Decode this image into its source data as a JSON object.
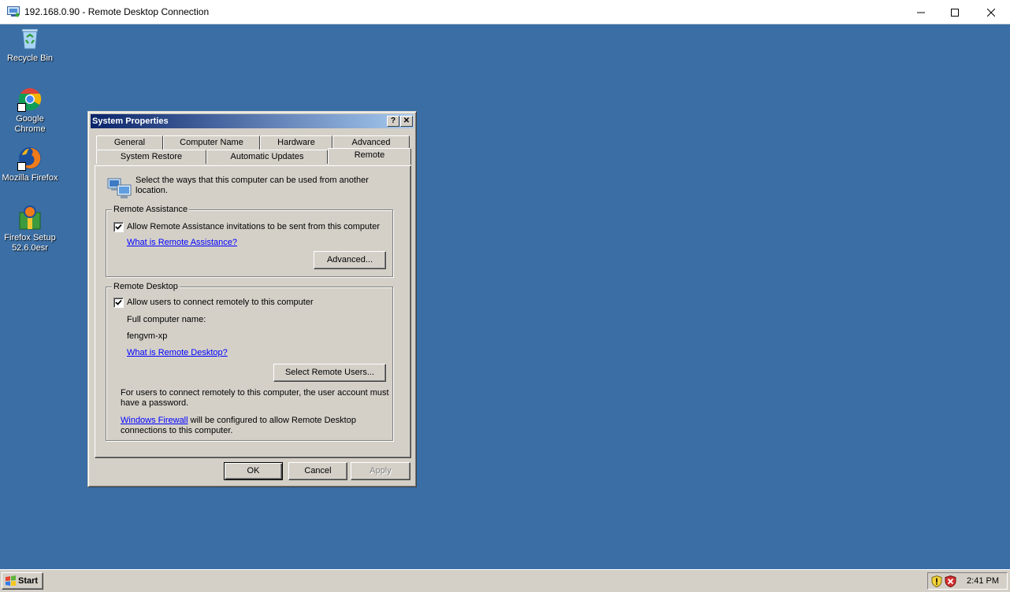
{
  "rdp_window": {
    "title": "192.168.0.90 - Remote Desktop Connection",
    "minimize_icon": "minimize-icon",
    "maximize_icon": "maximize-icon",
    "close_icon": "close-icon"
  },
  "desktop_icons": [
    {
      "label": "Recycle Bin",
      "icon": "recycle-bin-icon"
    },
    {
      "label": "Google Chrome",
      "icon": "chrome-icon"
    },
    {
      "label": "Mozilla Firefox",
      "icon": "firefox-icon"
    },
    {
      "label": "Firefox Setup 52.6.0esr",
      "icon": "installer-icon"
    }
  ],
  "dialog": {
    "title": "System Properties",
    "help_glyph": "?",
    "close_glyph": "✕",
    "tabs_row1": [
      "General",
      "Computer Name",
      "Hardware",
      "Advanced"
    ],
    "tabs_row2": [
      "System Restore",
      "Automatic Updates",
      "Remote"
    ],
    "active_tab": "Remote",
    "intro_line1": "Select the ways that this computer can be used from another",
    "intro_line2": "location.",
    "remote_assistance": {
      "group_title": "Remote Assistance",
      "checkbox_label": "Allow Remote Assistance invitations to be sent from this computer",
      "checked": true,
      "link": "What is Remote Assistance?",
      "advanced_button": "Advanced..."
    },
    "remote_desktop": {
      "group_title": "Remote Desktop",
      "checkbox_label": "Allow users to connect remotely to this computer",
      "checked": true,
      "full_name_label": "Full computer name:",
      "computer_name": "fengvm-xp",
      "link": "What is Remote Desktop?",
      "select_users_button": "Select Remote Users...",
      "note_line1": "For users to connect remotely to this computer, the user account must",
      "note_line2": "have a password.",
      "firewall_link": "Windows Firewall",
      "firewall_text1": " will be configured to allow Remote Desktop",
      "firewall_text2": "connections to this computer."
    },
    "buttons": {
      "ok": "OK",
      "cancel": "Cancel",
      "apply": "Apply"
    }
  },
  "taskbar": {
    "start_label": "Start",
    "clock": "2:41 PM",
    "tray_icons": [
      "security-shield-icon",
      "security-alert-icon"
    ]
  }
}
